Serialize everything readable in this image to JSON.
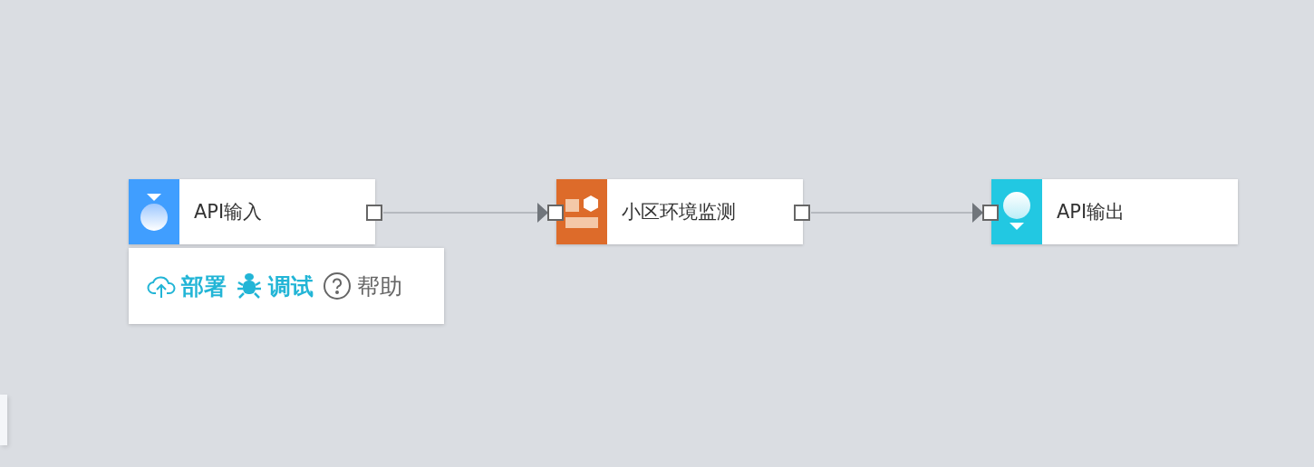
{
  "nodes": [
    {
      "kind": "input",
      "label": "API输入",
      "color": "#409eff"
    },
    {
      "kind": "process",
      "label": "小区环境监测",
      "color": "#dd6b2a"
    },
    {
      "kind": "output",
      "label": "API输出",
      "color": "#22c8e2"
    }
  ],
  "toolbar": [
    {
      "kind": "deploy",
      "label": "部署",
      "color": "#22b5d6"
    },
    {
      "kind": "debug",
      "label": "调试",
      "color": "#22b5d6"
    },
    {
      "kind": "help",
      "label": "帮助",
      "color": "#666666"
    }
  ]
}
